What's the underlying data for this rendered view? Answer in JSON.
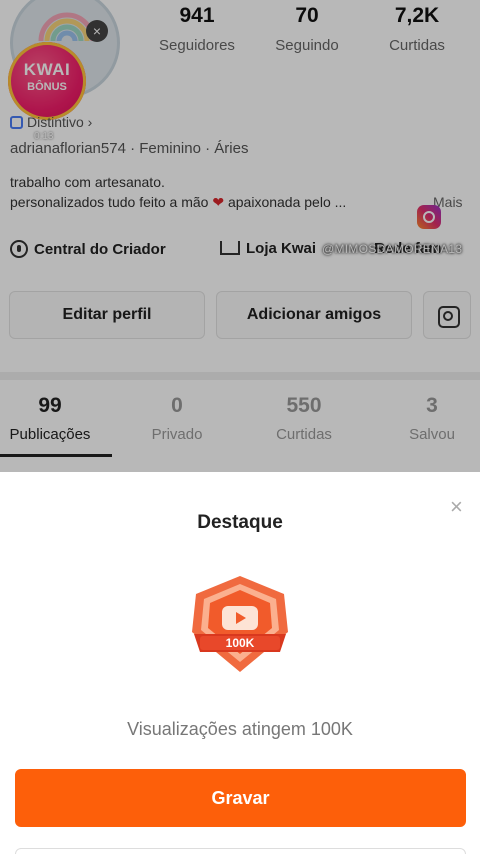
{
  "profile": {
    "stats": [
      {
        "value": "941",
        "label": "Seguidores"
      },
      {
        "value": "70",
        "label": "Seguindo"
      },
      {
        "value": "7,2K",
        "label": "Curtidas"
      }
    ],
    "kwai_bonus": {
      "line1": "KWAI",
      "line2": "BÔNUS",
      "timer": "0:13"
    },
    "badge": "Distintivo ›",
    "id_line": "adrianaflorian574 · Feminino · Áries",
    "bio_line1": "trabalho com artesanato.",
    "bio_line2_before": "personalizados tudo feito a mão",
    "bio_heart": "❤",
    "bio_line2_after": "apaixonada pelo ...",
    "bio_more": "Mais",
    "links": {
      "creator": "Central do Criador",
      "shop": "Loja Kwai",
      "family": "Rede fam"
    },
    "watermark": "@MIMOSDAMORENA13",
    "buttons": {
      "edit": "Editar perfil",
      "add_friends": "Adicionar amigos"
    }
  },
  "tabs": [
    {
      "count": "99",
      "label": "Publicações"
    },
    {
      "count": "0",
      "label": "Privado"
    },
    {
      "count": "550",
      "label": "Curtidas"
    },
    {
      "count": "3",
      "label": "Salvou"
    }
  ],
  "sheet": {
    "close": "×",
    "title": "Destaque",
    "medal_text": "100K",
    "description": "Visualizações atingem 100K",
    "record_button": "Gravar"
  },
  "colors": {
    "accent": "#fd5f0a",
    "kwai_pink": "#f21d6a"
  }
}
